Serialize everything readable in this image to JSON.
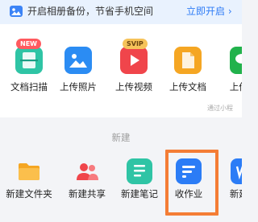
{
  "banner": {
    "text": "开启相册备份，节省手机空间",
    "action": "立即开启 ›"
  },
  "upload": {
    "items": [
      {
        "label": "文档扫描",
        "icon": "scan-icon",
        "badge": "NEW",
        "color": "#2fc4a5"
      },
      {
        "label": "上传照片",
        "icon": "photo-icon",
        "badge": "",
        "color": "#2b8cf3"
      },
      {
        "label": "上传视频",
        "icon": "video-icon",
        "badge": "SVIP",
        "color": "#f0454b"
      },
      {
        "label": "上传文档",
        "icon": "document-icon",
        "badge": "",
        "color": "#f5a623"
      },
      {
        "label": "上传微",
        "icon": "wechat-icon",
        "badge": "",
        "color": "#22b24c"
      }
    ],
    "recent_note": "通过小程"
  },
  "create": {
    "title": "新建",
    "items": [
      {
        "label": "新建文件夹",
        "icon": "folder-icon",
        "color": "#f5a623"
      },
      {
        "label": "新建共享",
        "icon": "share-people-icon",
        "color": "#f0454b"
      },
      {
        "label": "新建笔记",
        "icon": "note-icon",
        "color": "#2fc4a5"
      },
      {
        "label": "收作业",
        "icon": "homework-icon",
        "color": "#2b7cf6"
      },
      {
        "label": "新建W",
        "icon": "word-icon",
        "color": "#2b7cf6"
      }
    ]
  }
}
